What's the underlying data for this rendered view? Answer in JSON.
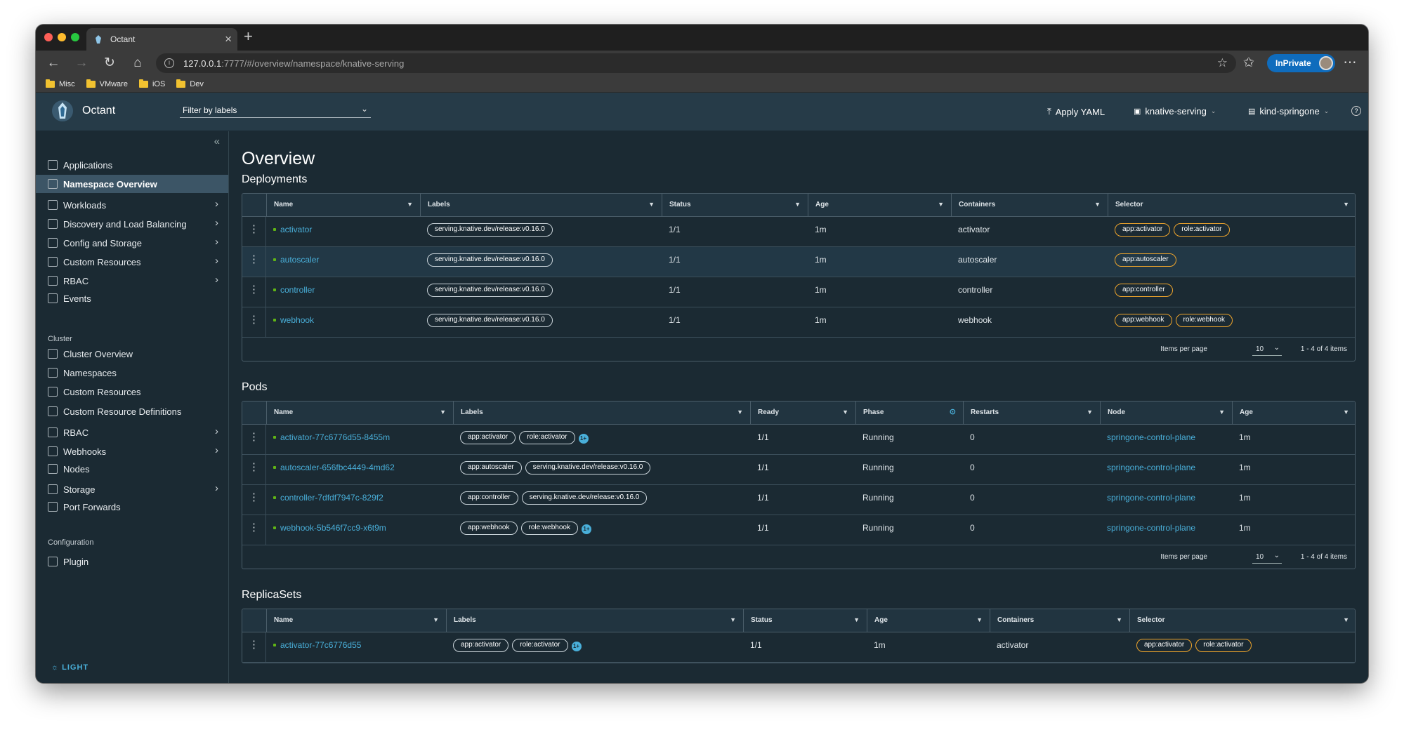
{
  "browser": {
    "tab_title": "Octant",
    "url_host": "127.0.0.1",
    "url_rest": ":7777/#/overview/namespace/knative-serving",
    "inprivate_label": "InPrivate",
    "bookmarks": [
      "Misc",
      "VMware",
      "iOS",
      "Dev"
    ]
  },
  "header": {
    "brand": "Octant",
    "filter_placeholder": "Filter by labels",
    "apply_yaml": "Apply YAML",
    "namespace": "knative-serving",
    "context": "kind-springone"
  },
  "sidebar": {
    "items": [
      {
        "label": "Applications",
        "arrow": false
      },
      {
        "label": "Namespace Overview",
        "arrow": false,
        "active": true
      },
      {
        "label": "Workloads",
        "arrow": true
      },
      {
        "label": "Discovery and Load Balancing",
        "arrow": true
      },
      {
        "label": "Config and Storage",
        "arrow": true
      },
      {
        "label": "Custom Resources",
        "arrow": true
      },
      {
        "label": "RBAC",
        "arrow": true
      },
      {
        "label": "Events",
        "arrow": false
      }
    ],
    "cluster_heading": "Cluster",
    "cluster_items": [
      {
        "label": "Cluster Overview",
        "arrow": false
      },
      {
        "label": "Namespaces",
        "arrow": false
      },
      {
        "label": "Custom Resources",
        "arrow": false
      },
      {
        "label": "Custom Resource Definitions",
        "arrow": false
      },
      {
        "label": "RBAC",
        "arrow": true
      },
      {
        "label": "Webhooks",
        "arrow": true
      },
      {
        "label": "Nodes",
        "arrow": false
      },
      {
        "label": "Storage",
        "arrow": true
      },
      {
        "label": "Port Forwards",
        "arrow": false
      }
    ],
    "config_heading": "Configuration",
    "config_items": [
      {
        "label": "Plugin",
        "arrow": false
      }
    ],
    "theme_toggle": "LIGHT"
  },
  "main": {
    "title": "Overview",
    "deployments": {
      "title": "Deployments",
      "columns": [
        "Name",
        "Labels",
        "Status",
        "Age",
        "Containers",
        "Selector"
      ],
      "rows": [
        {
          "name": "activator",
          "labels": [
            "serving.knative.dev/release:v0.16.0"
          ],
          "status": "1/1",
          "age": "1m",
          "containers": "activator",
          "selector": [
            "app:activator",
            "role:activator"
          ]
        },
        {
          "name": "autoscaler",
          "labels": [
            "serving.knative.dev/release:v0.16.0"
          ],
          "status": "1/1",
          "age": "1m",
          "containers": "autoscaler",
          "selector": [
            "app:autoscaler"
          ]
        },
        {
          "name": "controller",
          "labels": [
            "serving.knative.dev/release:v0.16.0"
          ],
          "status": "1/1",
          "age": "1m",
          "containers": "controller",
          "selector": [
            "app:controller"
          ]
        },
        {
          "name": "webhook",
          "labels": [
            "serving.knative.dev/release:v0.16.0"
          ],
          "status": "1/1",
          "age": "1m",
          "containers": "webhook",
          "selector": [
            "app:webhook",
            "role:webhook"
          ]
        }
      ],
      "items_per_page_label": "Items per page",
      "per_page": "10",
      "count": "1 - 4 of 4 items"
    },
    "pods": {
      "title": "Pods",
      "columns": [
        "Name",
        "Labels",
        "Ready",
        "Phase",
        "Restarts",
        "Node",
        "Age"
      ],
      "rows": [
        {
          "name": "activator-77c6776d55-8455m",
          "labels": [
            "app:activator",
            "role:activator"
          ],
          "more": "1+",
          "ready": "1/1",
          "phase": "Running",
          "restarts": "0",
          "node": "springone-control-plane",
          "age": "1m"
        },
        {
          "name": "autoscaler-656fbc4449-4md62",
          "labels": [
            "app:autoscaler",
            "serving.knative.dev/release:v0.16.0"
          ],
          "more": "",
          "ready": "1/1",
          "phase": "Running",
          "restarts": "0",
          "node": "springone-control-plane",
          "age": "1m"
        },
        {
          "name": "controller-7dfdf7947c-829f2",
          "labels": [
            "app:controller",
            "serving.knative.dev/release:v0.16.0"
          ],
          "more": "",
          "ready": "1/1",
          "phase": "Running",
          "restarts": "0",
          "node": "springone-control-plane",
          "age": "1m"
        },
        {
          "name": "webhook-5b546f7cc9-x6t9m",
          "labels": [
            "app:webhook",
            "role:webhook"
          ],
          "more": "1+",
          "ready": "1/1",
          "phase": "Running",
          "restarts": "0",
          "node": "springone-control-plane",
          "age": "1m"
        }
      ],
      "items_per_page_label": "Items per page",
      "per_page": "10",
      "count": "1 - 4 of 4 items"
    },
    "replicasets": {
      "title": "ReplicaSets",
      "columns": [
        "Name",
        "Labels",
        "Status",
        "Age",
        "Containers",
        "Selector"
      ],
      "rows": [
        {
          "name": "activator-77c6776d55",
          "labels": [
            "app:activator",
            "role:activator"
          ],
          "more": "1+",
          "status": "1/1",
          "age": "1m",
          "containers": "activator",
          "selector": [
            "app:activator",
            "role:activator"
          ]
        }
      ]
    }
  },
  "colors": {
    "link": "#49afd9",
    "selector_border": "#efa52c",
    "active_nav": "#3c5566",
    "header_bg": "#263b48",
    "content_bg": "#1b2a33",
    "inprivate": "#0f6cbd"
  }
}
